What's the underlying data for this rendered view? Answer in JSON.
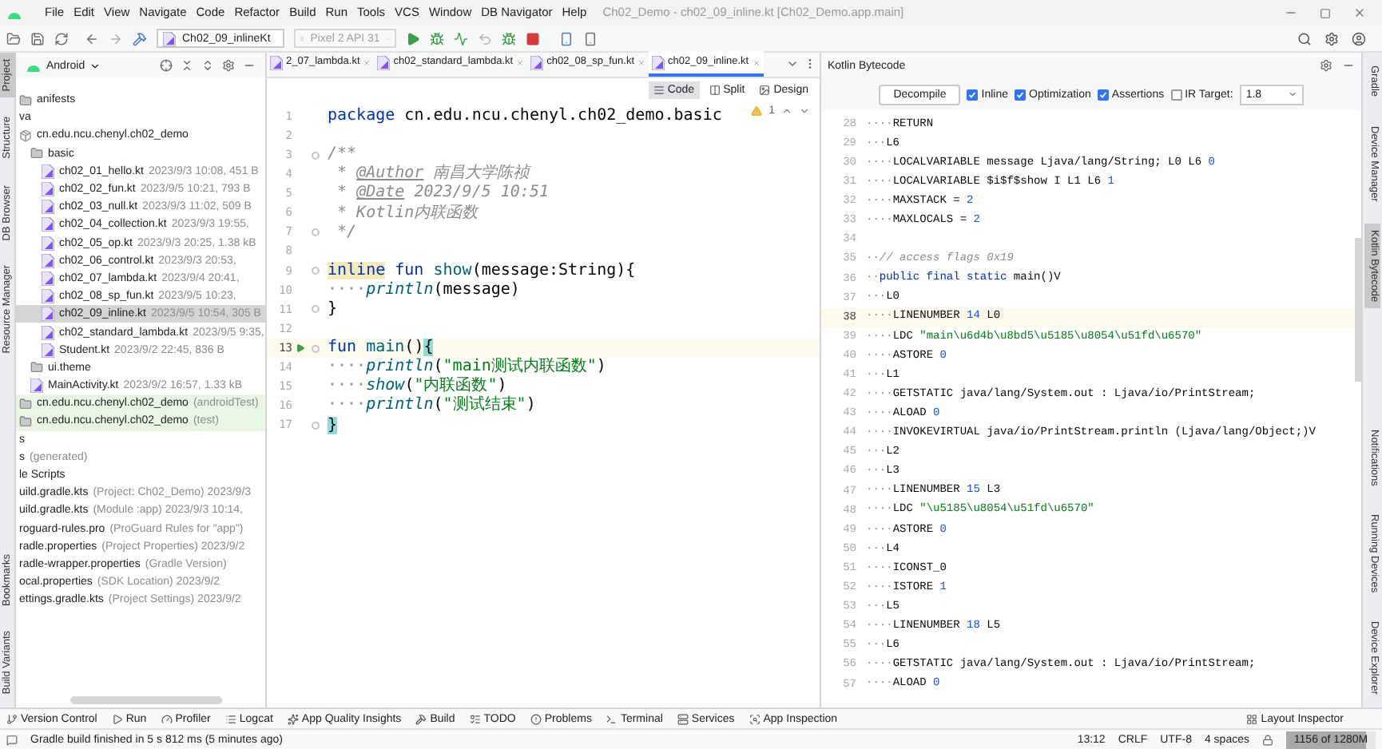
{
  "title_bar": {
    "menu": [
      "File",
      "Edit",
      "View",
      "Navigate",
      "Code",
      "Refactor",
      "Build",
      "Run",
      "Tools",
      "VCS",
      "Window",
      "DB Navigator",
      "Help"
    ],
    "title": "Ch02_Demo - ch02_09_inline.kt [Ch02_Demo.app.main]"
  },
  "toolbar": {
    "run_configuration": "Ch02_09_inlineKt",
    "device": {
      "label": "Pixel 2 API 31",
      "disabled": true
    }
  },
  "left_stripe": {
    "top": [
      {
        "label": "Project",
        "selected": true
      },
      {
        "label": "Structure",
        "selected": false
      },
      {
        "label": "DB Browser",
        "selected": false
      },
      {
        "label": "Resource Manager",
        "selected": false
      }
    ],
    "bottom": [
      {
        "label": "Bookmarks",
        "selected": false
      },
      {
        "label": "Build Variants",
        "selected": false
      }
    ]
  },
  "project_panel": {
    "view": "Android",
    "tree": [
      {
        "name": "anifests",
        "kind": "folder",
        "selected": false
      },
      {
        "name": "va",
        "kind": "plain",
        "selected": false
      },
      {
        "name": "cn.edu.ncu.chenyl.ch02_demo",
        "kind": "package",
        "selected": false,
        "children": [
          {
            "name": "basic",
            "kind": "folder",
            "selected": false,
            "children": [
              {
                "name": "ch02_01_hello.kt",
                "detail": "2023/9/3 10:08, 451 B",
                "kind": "kotlin",
                "selected": false
              },
              {
                "name": "ch02_02_fun.kt",
                "detail": "2023/9/5 10:21, 793 B",
                "kind": "kotlin",
                "selected": false
              },
              {
                "name": "ch02_03_null.kt",
                "detail": "2023/9/3 11:02, 509 B",
                "kind": "kotlin",
                "selected": false
              },
              {
                "name": "ch02_04_collection.kt",
                "detail": "2023/9/3 19:55,",
                "kind": "kotlin",
                "selected": false
              },
              {
                "name": "ch02_05_op.kt",
                "detail": "2023/9/3 20:25, 1.38 kB",
                "kind": "kotlin",
                "selected": false
              },
              {
                "name": "ch02_06_control.kt",
                "detail": "2023/9/3 20:53,",
                "kind": "kotlin",
                "selected": false
              },
              {
                "name": "ch02_07_lambda.kt",
                "detail": "2023/9/4 20:41,",
                "kind": "kotlin",
                "selected": false
              },
              {
                "name": "ch02_08_sp_fun.kt",
                "detail": "2023/9/5 10:23,",
                "kind": "kotlin",
                "selected": false
              },
              {
                "name": "ch02_09_inline.kt",
                "detail": "2023/9/5 10:54, 305 B",
                "kind": "kotlin",
                "selected": true
              },
              {
                "name": "ch02_standard_lambda.kt",
                "detail": "2023/9/5 9:35,",
                "kind": "kotlin",
                "selected": false
              },
              {
                "name": "Student.kt",
                "detail": "2023/9/2 22:45, 836 B",
                "kind": "kotlin",
                "selected": false
              }
            ]
          },
          {
            "name": "ui.theme",
            "kind": "folder",
            "selected": false
          },
          {
            "name": "MainActivity.kt",
            "detail": "2023/9/2 16:57, 1.33 kB",
            "kind": "kotlin",
            "selected": false
          }
        ]
      },
      {
        "name": "cn.edu.ncu.chenyl.ch02_demo",
        "detail": "(androidTest)",
        "kind": "test-package",
        "selected": false
      },
      {
        "name": "cn.edu.ncu.chenyl.ch02_demo",
        "detail": "(test)",
        "kind": "test-package",
        "selected": false
      },
      {
        "name": "s",
        "kind": "plain",
        "selected": false
      },
      {
        "name": "s",
        "detail": "(generated)",
        "kind": "plain",
        "selected": false
      },
      {
        "name": "le Scripts",
        "kind": "plain",
        "selected": false
      },
      {
        "name": "uild.gradle.kts",
        "detail": "(Project: Ch02_Demo) 2023/9/3",
        "kind": "plain",
        "selected": false
      },
      {
        "name": "uild.gradle.kts",
        "detail": "(Module :app) 2023/9/3 10:14,",
        "kind": "plain",
        "selected": false
      },
      {
        "name": "roguard-rules.pro",
        "detail": "(ProGuard Rules for \"app\")",
        "kind": "plain",
        "selected": false
      },
      {
        "name": "radle.properties",
        "detail": "(Project Properties) 2023/9/2",
        "kind": "plain",
        "selected": false
      },
      {
        "name": "radle-wrapper.properties",
        "detail": "(Gradle Version)",
        "kind": "plain",
        "selected": false
      },
      {
        "name": "ocal.properties",
        "detail": "(SDK Location) 2023/9/2",
        "kind": "plain",
        "selected": false
      },
      {
        "name": "ettings.gradle.kts",
        "detail": "(Project Settings) 2023/9/2",
        "kind": "plain",
        "selected": false
      }
    ]
  },
  "editor": {
    "tabs": [
      {
        "label": "2_07_lambda.kt",
        "selected": false
      },
      {
        "label": "ch02_standard_lambda.kt",
        "selected": false
      },
      {
        "label": "ch02_08_sp_fun.kt",
        "selected": false
      },
      {
        "label": "ch02_09_inline.kt",
        "selected": true
      }
    ],
    "view_modes": [
      {
        "label": "Code",
        "selected": true
      },
      {
        "label": "Split",
        "selected": false
      },
      {
        "label": "Design",
        "selected": false
      }
    ],
    "warnings": "1",
    "lines": [
      {
        "no": "1",
        "current": false,
        "run": false,
        "fold": false,
        "tokens": [
          {
            "kind": "keyword",
            "text": "package"
          },
          {
            "kind": "plain",
            "text": " cn.edu.ncu.chenyl.ch02_demo.basic"
          }
        ]
      },
      {
        "no": "2",
        "current": false,
        "run": false,
        "fold": false
      },
      {
        "no": "3",
        "current": false,
        "run": false,
        "fold": true,
        "tokens": [
          {
            "kind": "comment",
            "text": "/**"
          }
        ]
      },
      {
        "no": "4",
        "current": false,
        "run": false,
        "fold": false,
        "tokens": [
          {
            "kind": "comment",
            "text": " * "
          },
          {
            "kind": "doc-tag",
            "text": "@Author"
          },
          {
            "kind": "comment",
            "text": " 南昌大学陈祯"
          }
        ]
      },
      {
        "no": "5",
        "current": false,
        "run": false,
        "fold": false,
        "tokens": [
          {
            "kind": "comment",
            "text": " * "
          },
          {
            "kind": "doc-tag",
            "text": "@Date"
          },
          {
            "kind": "comment",
            "text": " 2023/9/5 10:51"
          }
        ]
      },
      {
        "no": "6",
        "current": false,
        "run": false,
        "fold": false,
        "tokens": [
          {
            "kind": "comment",
            "text": " * Kotlin内联函数"
          }
        ]
      },
      {
        "no": "7",
        "current": false,
        "run": false,
        "fold": true,
        "tokens": [
          {
            "kind": "comment",
            "text": " */"
          }
        ]
      },
      {
        "no": "8",
        "current": false,
        "run": false,
        "fold": false
      },
      {
        "no": "9",
        "current": false,
        "run": false,
        "fold": true,
        "tokens": [
          {
            "kind": "highlighted-keyword",
            "text": "inline"
          },
          {
            "kind": "keyword",
            "text": " fun"
          },
          {
            "kind": "function",
            "text": " show"
          },
          {
            "kind": "plain",
            "text": "(message:String){"
          }
        ]
      },
      {
        "no": "10",
        "current": false,
        "run": false,
        "fold": false,
        "tokens": [
          {
            "kind": "whitespace",
            "text": "····"
          },
          {
            "kind": "call",
            "text": "println"
          },
          {
            "kind": "plain",
            "text": "(message)"
          }
        ]
      },
      {
        "no": "11",
        "current": false,
        "run": false,
        "fold": true,
        "tokens": [
          {
            "kind": "plain",
            "text": "}"
          }
        ]
      },
      {
        "no": "12",
        "current": false,
        "run": false,
        "fold": false
      },
      {
        "no": "13",
        "current": true,
        "run": true,
        "fold": true,
        "tokens": [
          {
            "kind": "keyword",
            "text": "fun"
          },
          {
            "kind": "function",
            "text": " main"
          },
          {
            "kind": "plain",
            "text": "()"
          },
          {
            "kind": "matched-brace",
            "text": "{"
          }
        ]
      },
      {
        "no": "14",
        "current": false,
        "run": false,
        "fold": false,
        "tokens": [
          {
            "kind": "whitespace",
            "text": "····"
          },
          {
            "kind": "call",
            "text": "println"
          },
          {
            "kind": "plain",
            "text": "("
          },
          {
            "kind": "string",
            "text": "\"main测试内联函数\""
          },
          {
            "kind": "plain",
            "text": ")"
          }
        ]
      },
      {
        "no": "15",
        "current": false,
        "run": false,
        "fold": false,
        "tokens": [
          {
            "kind": "whitespace",
            "text": "····"
          },
          {
            "kind": "call",
            "text": "show"
          },
          {
            "kind": "plain",
            "text": "("
          },
          {
            "kind": "string",
            "text": "\"内联函数\""
          },
          {
            "kind": "plain",
            "text": ")"
          }
        ]
      },
      {
        "no": "16",
        "current": false,
        "run": false,
        "fold": false,
        "tokens": [
          {
            "kind": "whitespace",
            "text": "····"
          },
          {
            "kind": "call",
            "text": "println"
          },
          {
            "kind": "plain",
            "text": "("
          },
          {
            "kind": "string",
            "text": "\"测试结束\""
          },
          {
            "kind": "plain",
            "text": ")"
          }
        ]
      },
      {
        "no": "17",
        "current": false,
        "run": false,
        "fold": true,
        "tokens": [
          {
            "kind": "matched-brace",
            "text": "}"
          }
        ]
      }
    ]
  },
  "bytecode_panel": {
    "title": "Kotlin Bytecode",
    "decompile": "Decompile",
    "options": [
      {
        "label": "Inline",
        "checked": true
      },
      {
        "label": "Optimization",
        "checked": true
      },
      {
        "label": "Assertions",
        "checked": true
      },
      {
        "label": "IR Target:",
        "checked": false
      }
    ],
    "target": "1.8",
    "lines": [
      {
        "no": "28",
        "current": false,
        "tokens": [
          {
            "kind": "whitespace",
            "text": "····"
          },
          {
            "kind": "plain",
            "text": "RETURN"
          }
        ]
      },
      {
        "no": "29",
        "current": false,
        "tokens": [
          {
            "kind": "whitespace",
            "text": "···"
          },
          {
            "kind": "plain",
            "text": "L6"
          }
        ]
      },
      {
        "no": "30",
        "current": false,
        "tokens": [
          {
            "kind": "whitespace",
            "text": "····"
          },
          {
            "kind": "plain",
            "text": "LOCALVARIABLE message Ljava/lang/String; L0 L6 "
          },
          {
            "kind": "number",
            "text": "0"
          }
        ]
      },
      {
        "no": "31",
        "current": false,
        "tokens": [
          {
            "kind": "whitespace",
            "text": "····"
          },
          {
            "kind": "plain",
            "text": "LOCALVARIABLE $i$f$show I L1 L6 "
          },
          {
            "kind": "number",
            "text": "1"
          }
        ]
      },
      {
        "no": "32",
        "current": false,
        "tokens": [
          {
            "kind": "whitespace",
            "text": "····"
          },
          {
            "kind": "plain",
            "text": "MAXSTACK = "
          },
          {
            "kind": "number",
            "text": "2"
          }
        ]
      },
      {
        "no": "33",
        "current": false,
        "tokens": [
          {
            "kind": "whitespace",
            "text": "····"
          },
          {
            "kind": "plain",
            "text": "MAXLOCALS = "
          },
          {
            "kind": "number",
            "text": "2"
          }
        ]
      },
      {
        "no": "34",
        "current": false
      },
      {
        "no": "35",
        "current": false,
        "tokens": [
          {
            "kind": "whitespace",
            "text": "··"
          },
          {
            "kind": "comment",
            "text": "// access flags 0x19"
          }
        ]
      },
      {
        "no": "36",
        "current": false,
        "tokens": [
          {
            "kind": "whitespace",
            "text": "··"
          },
          {
            "kind": "keyword",
            "text": "public final static"
          },
          {
            "kind": "plain",
            "text": " main()V"
          }
        ]
      },
      {
        "no": "37",
        "current": false,
        "tokens": [
          {
            "kind": "whitespace",
            "text": "···"
          },
          {
            "kind": "plain",
            "text": "L0"
          }
        ]
      },
      {
        "no": "38",
        "current": true,
        "tokens": [
          {
            "kind": "whitespace",
            "text": "····"
          },
          {
            "kind": "plain",
            "text": "LINENUMBER "
          },
          {
            "kind": "number",
            "text": "14"
          },
          {
            "kind": "plain",
            "text": " L0"
          }
        ]
      },
      {
        "no": "39",
        "current": false,
        "tokens": [
          {
            "kind": "whitespace",
            "text": "····"
          },
          {
            "kind": "plain",
            "text": "LDC "
          },
          {
            "kind": "string",
            "text": "\"main\\u6d4b\\u8bd5\\u5185\\u8054\\u51fd\\u6570\""
          }
        ]
      },
      {
        "no": "40",
        "current": false,
        "tokens": [
          {
            "kind": "whitespace",
            "text": "····"
          },
          {
            "kind": "plain",
            "text": "ASTORE "
          },
          {
            "kind": "number",
            "text": "0"
          }
        ]
      },
      {
        "no": "41",
        "current": false,
        "tokens": [
          {
            "kind": "whitespace",
            "text": "···"
          },
          {
            "kind": "plain",
            "text": "L1"
          }
        ]
      },
      {
        "no": "42",
        "current": false,
        "tokens": [
          {
            "kind": "whitespace",
            "text": "····"
          },
          {
            "kind": "plain",
            "text": "GETSTATIC java/lang/System.out : Ljava/io/PrintStream;"
          }
        ]
      },
      {
        "no": "43",
        "current": false,
        "tokens": [
          {
            "kind": "whitespace",
            "text": "····"
          },
          {
            "kind": "plain",
            "text": "ALOAD "
          },
          {
            "kind": "number",
            "text": "0"
          }
        ]
      },
      {
        "no": "44",
        "current": false,
        "tokens": [
          {
            "kind": "whitespace",
            "text": "····"
          },
          {
            "kind": "plain",
            "text": "INVOKEVIRTUAL java/io/PrintStream.println (Ljava/lang/Object;)V"
          }
        ]
      },
      {
        "no": "45",
        "current": false,
        "tokens": [
          {
            "kind": "whitespace",
            "text": "···"
          },
          {
            "kind": "plain",
            "text": "L2"
          }
        ]
      },
      {
        "no": "46",
        "current": false,
        "tokens": [
          {
            "kind": "whitespace",
            "text": "···"
          },
          {
            "kind": "plain",
            "text": "L3"
          }
        ]
      },
      {
        "no": "47",
        "current": false,
        "tokens": [
          {
            "kind": "whitespace",
            "text": "····"
          },
          {
            "kind": "plain",
            "text": "LINENUMBER "
          },
          {
            "kind": "number",
            "text": "15"
          },
          {
            "kind": "plain",
            "text": " L3"
          }
        ]
      },
      {
        "no": "48",
        "current": false,
        "tokens": [
          {
            "kind": "whitespace",
            "text": "····"
          },
          {
            "kind": "plain",
            "text": "LDC "
          },
          {
            "kind": "string",
            "text": "\"\\u5185\\u8054\\u51fd\\u6570\""
          }
        ]
      },
      {
        "no": "49",
        "current": false,
        "tokens": [
          {
            "kind": "whitespace",
            "text": "····"
          },
          {
            "kind": "plain",
            "text": "ASTORE "
          },
          {
            "kind": "number",
            "text": "0"
          }
        ]
      },
      {
        "no": "50",
        "current": false,
        "tokens": [
          {
            "kind": "whitespace",
            "text": "···"
          },
          {
            "kind": "plain",
            "text": "L4"
          }
        ]
      },
      {
        "no": "51",
        "current": false,
        "tokens": [
          {
            "kind": "whitespace",
            "text": "····"
          },
          {
            "kind": "plain",
            "text": "ICONST_0"
          }
        ]
      },
      {
        "no": "52",
        "current": false,
        "tokens": [
          {
            "kind": "whitespace",
            "text": "····"
          },
          {
            "kind": "plain",
            "text": "ISTORE "
          },
          {
            "kind": "number",
            "text": "1"
          }
        ]
      },
      {
        "no": "53",
        "current": false,
        "tokens": [
          {
            "kind": "whitespace",
            "text": "···"
          },
          {
            "kind": "plain",
            "text": "L5"
          }
        ]
      },
      {
        "no": "54",
        "current": false,
        "tokens": [
          {
            "kind": "whitespace",
            "text": "····"
          },
          {
            "kind": "plain",
            "text": "LINENUMBER "
          },
          {
            "kind": "number",
            "text": "18"
          },
          {
            "kind": "plain",
            "text": " L5"
          }
        ]
      },
      {
        "no": "55",
        "current": false,
        "tokens": [
          {
            "kind": "whitespace",
            "text": "···"
          },
          {
            "kind": "plain",
            "text": "L6"
          }
        ]
      },
      {
        "no": "56",
        "current": false,
        "tokens": [
          {
            "kind": "whitespace",
            "text": "····"
          },
          {
            "kind": "plain",
            "text": "GETSTATIC java/lang/System.out : Ljava/io/PrintStream;"
          }
        ]
      },
      {
        "no": "57",
        "current": false,
        "tokens": [
          {
            "kind": "whitespace",
            "text": "····"
          },
          {
            "kind": "plain",
            "text": "ALOAD "
          },
          {
            "kind": "number",
            "text": "0"
          }
        ]
      }
    ]
  },
  "right_stripe": {
    "top": [
      {
        "label": "Gradle",
        "selected": false
      },
      {
        "label": "Device Manager",
        "selected": false
      },
      {
        "label": "Kotlin Bytecode",
        "selected": true
      }
    ],
    "bottom": [
      {
        "label": "Notifications",
        "selected": false
      },
      {
        "label": "Running Devices",
        "selected": false
      },
      {
        "label": "Device Explorer",
        "selected": false
      }
    ]
  },
  "tool_bar_bottom": [
    "Version Control",
    "Run",
    "Profiler",
    "Logcat",
    "App Quality Insights",
    "Build",
    "TODO",
    "Problems",
    "Terminal",
    "Services",
    "App Inspection",
    "Layout Inspector"
  ],
  "status_bar": {
    "message": "Gradle build finished in 5 s 812 ms (5 minutes ago)",
    "position": "13:12",
    "line_separator": "CRLF",
    "encoding": "UTF-8",
    "indent": "4 spaces",
    "memory": {
      "text": "1156 of 1280M",
      "level": 0.9
    }
  }
}
